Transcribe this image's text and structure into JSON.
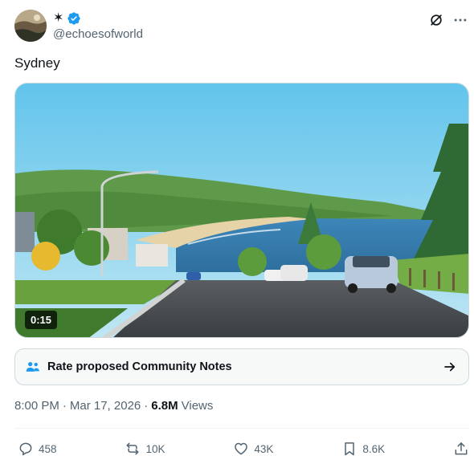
{
  "author": {
    "display_name": "✶",
    "handle": "@echoesofworld",
    "verified": true
  },
  "tweet": {
    "text": "Sydney"
  },
  "media": {
    "duration": "0:15"
  },
  "community_notes": {
    "label": "Rate proposed Community Notes"
  },
  "meta": {
    "time": "8:00 PM",
    "separator1": "·",
    "date": "Mar 17, 2026",
    "separator2": "·",
    "views_count": "6.8M",
    "views_label": "Views"
  },
  "actions": {
    "replies": "458",
    "reposts": "10K",
    "likes": "43K",
    "bookmarks": "8.6K"
  },
  "colors": {
    "verified_blue": "#1d9bf0",
    "text_secondary": "#536471",
    "text_primary": "#0f1419"
  }
}
